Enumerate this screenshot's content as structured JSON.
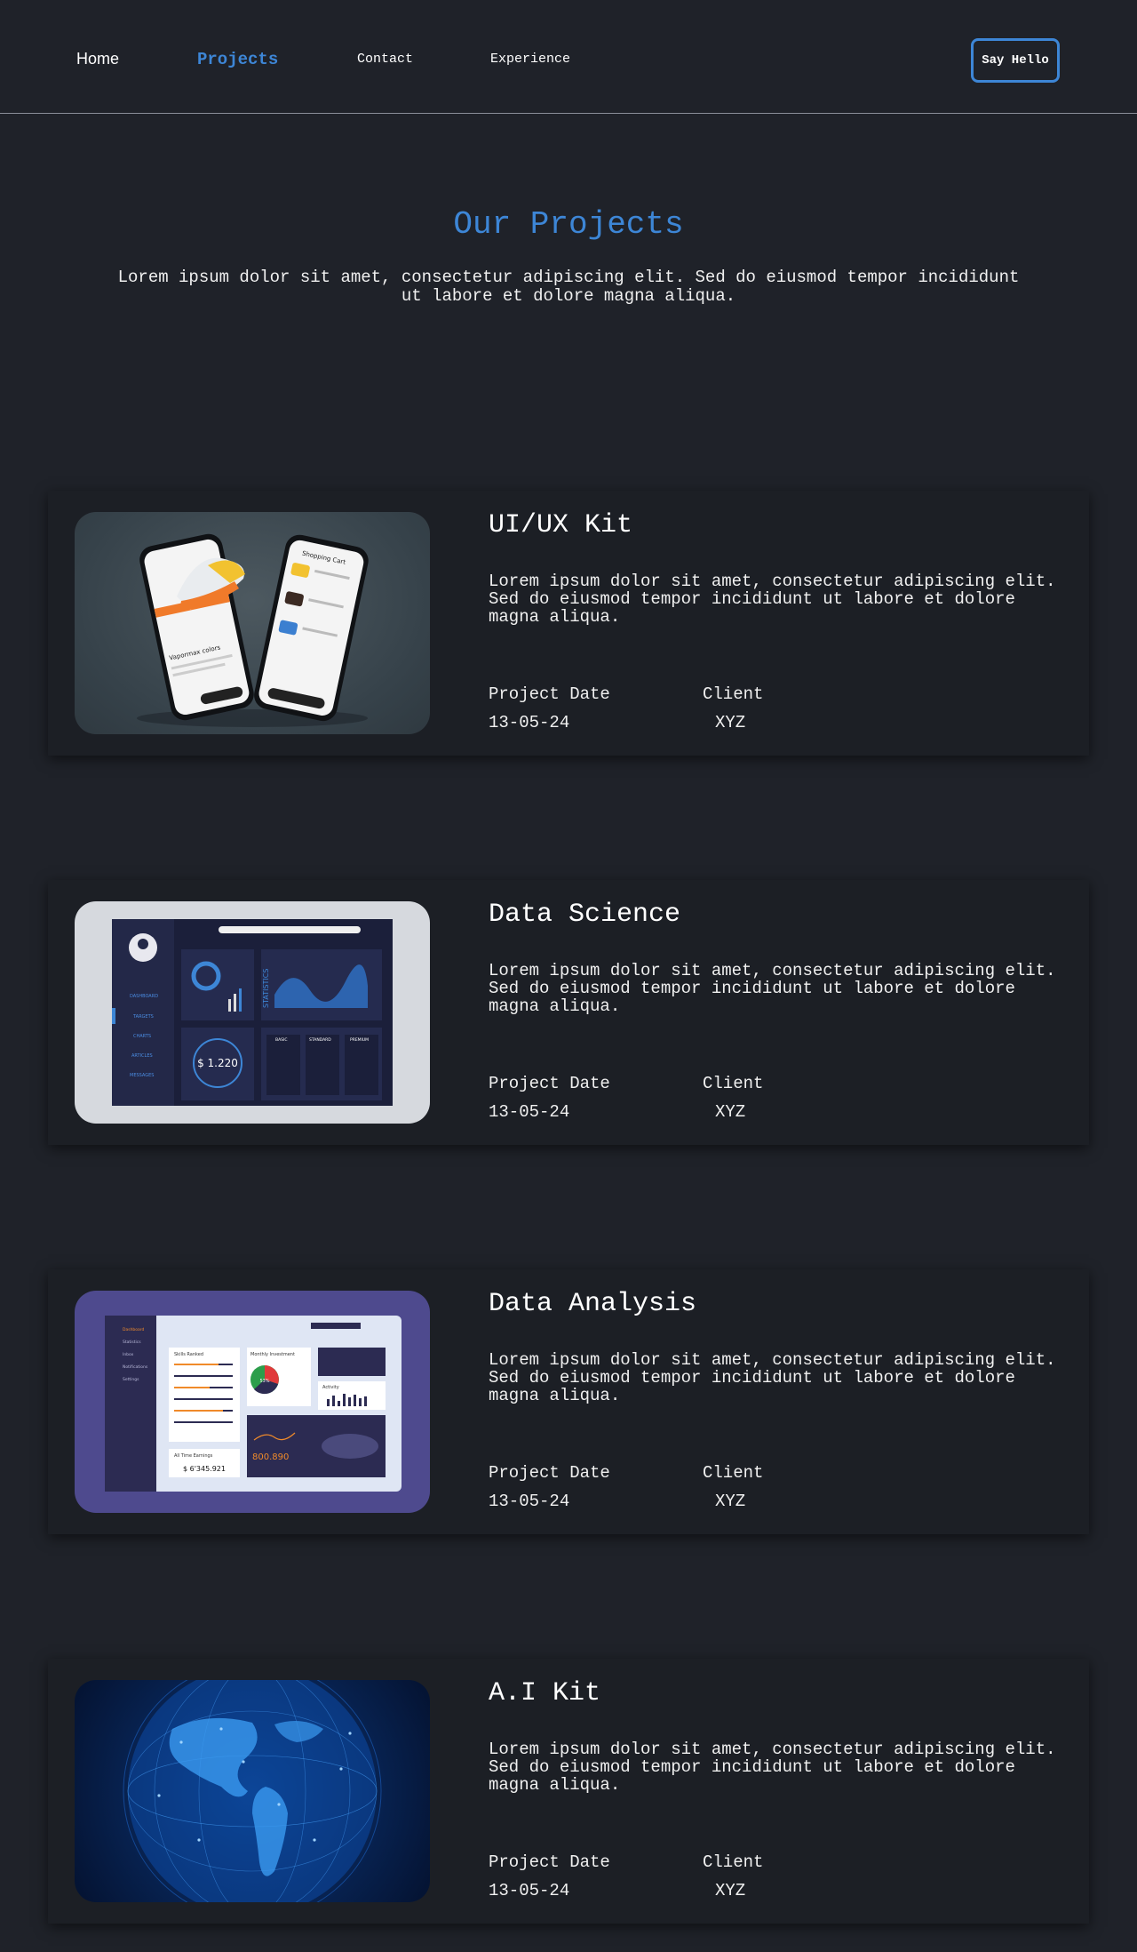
{
  "nav": {
    "home": "Home",
    "projects": "Projects",
    "contact": "Contact",
    "experience": "Experience",
    "say_hello": "Say Hello"
  },
  "hero": {
    "title": "Our Projects",
    "description": "Lorem ipsum dolor sit amet, consectetur adipiscing elit. Sed do eiusmod tempor incididunt ut labore et dolore magna aliqua."
  },
  "projects": [
    {
      "title": "UI/UX Kit",
      "description": "Lorem ipsum dolor sit amet, consectetur adipiscing elit. Sed do eiusmod tempor incididunt ut labore et dolore magna aliqua.",
      "date_label": "Project Date",
      "client_label": "Client",
      "date": "13-05-24",
      "client": "XYZ",
      "image": {
        "phone_left_caption": "Vaporrnax colors",
        "phone_right_title": "Shopping Cart"
      }
    },
    {
      "title": "Data Science",
      "description": "Lorem ipsum dolor sit amet, consectetur adipiscing elit. Sed do eiusmod tempor incididunt ut labore et dolore magna aliqua.",
      "date_label": "Project Date",
      "client_label": "Client",
      "date": "13-05-24",
      "client": "XYZ",
      "image": {
        "metric": "$ 1.220",
        "side_label": "STATISTICS",
        "plans": [
          "BASIC",
          "STANDARD",
          "PREMIUM"
        ],
        "menu": [
          "DASHBOARD",
          "TARGETS",
          "CHARTS",
          "ARTICLES",
          "MESSAGES"
        ]
      }
    },
    {
      "title": "Data Analysis",
      "description": "Lorem ipsum dolor sit amet, consectetur adipiscing elit. Sed do eiusmod tempor incididunt ut labore et dolore magna aliqua.",
      "date_label": "Project Date",
      "client_label": "Client",
      "date": "13-05-24",
      "client": "XYZ",
      "image": {
        "big_value": "800.890",
        "total_label": "All Time Earnings",
        "total_value": "$ 6'345.921",
        "pie_label": "53%",
        "panel_titles": [
          "Skills Ranked",
          "Monthly Investment",
          "Activity"
        ],
        "menu": [
          "Dashboard",
          "Statistics",
          "Inbox",
          "Notifications",
          "Settings"
        ]
      }
    },
    {
      "title": "A.I Kit",
      "description": "Lorem ipsum dolor sit amet, consectetur adipiscing elit. Sed do eiusmod tempor incididunt ut labore et dolore magna aliqua.",
      "date_label": "Project Date",
      "client_label": "Client",
      "date": "13-05-24",
      "client": "XYZ"
    }
  ],
  "colors": {
    "background": "#1f2229",
    "card": "#1c1f25",
    "accent": "#3d86d6",
    "text": "#f0f0f0"
  }
}
